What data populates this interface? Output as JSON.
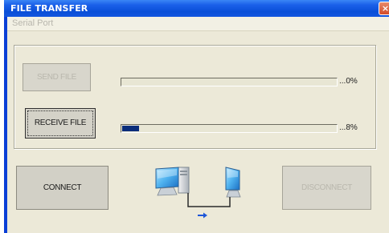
{
  "window": {
    "title": "FILE TRANSFER",
    "close_glyph": "×"
  },
  "menu": {
    "items": [
      "Serial Port"
    ]
  },
  "transfer": {
    "send": {
      "label": "SEND FILE",
      "enabled": false,
      "progress_percent": 0,
      "progress_text": "...0%"
    },
    "receive": {
      "label": "RECEIVE FILE",
      "enabled": true,
      "focused": true,
      "progress_percent": 8,
      "progress_text": "...8%"
    }
  },
  "connection": {
    "connect_label": "CONNECT",
    "connect_enabled": true,
    "disconnect_label": "DISCONNECT",
    "disconnect_enabled": false,
    "icon": "network-computers-icon",
    "direction_icon": "arrow-right-icon"
  },
  "colors": {
    "titlebar": "#0a4fd8",
    "progress_fill": "#0a2d7a",
    "window_bg": "#ece9d8"
  }
}
